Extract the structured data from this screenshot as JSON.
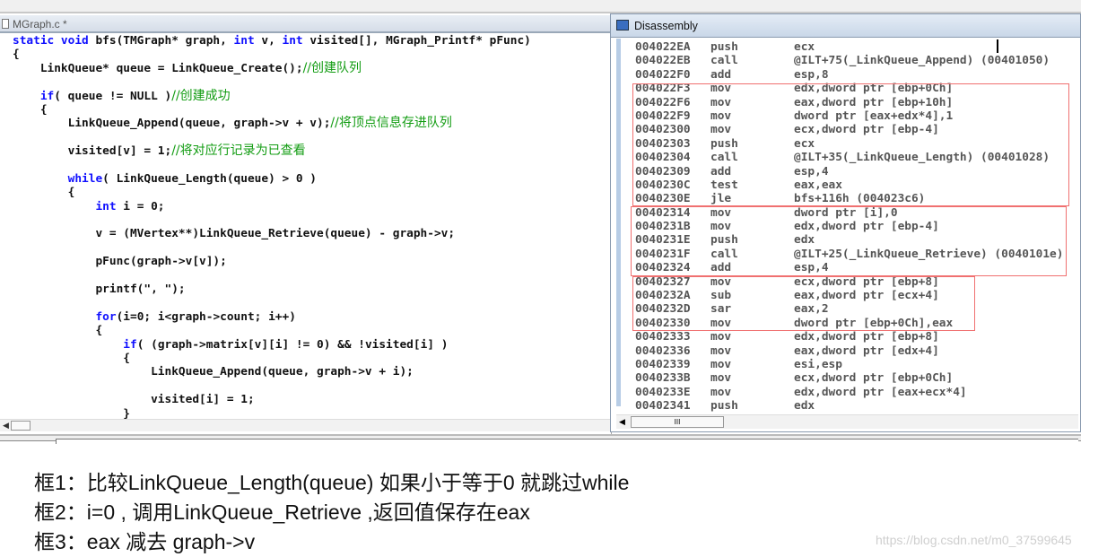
{
  "editor": {
    "tab_title": "MGraph.c *",
    "lines": [
      [
        {
          "t": "static void",
          "c": "kw"
        },
        {
          "t": " bfs(TMGraph* graph, ",
          "c": "tx"
        },
        {
          "t": "int",
          "c": "kw"
        },
        {
          "t": " v, ",
          "c": "tx"
        },
        {
          "t": "int",
          "c": "kw"
        },
        {
          "t": " visited[], MGraph_Printf* pFunc)",
          "c": "tx"
        }
      ],
      [
        {
          "t": "{",
          "c": "tx"
        }
      ],
      [
        {
          "t": "    LinkQueue* queue = LinkQueue_Create();",
          "c": "tx"
        },
        {
          "t": "//创建队列",
          "c": "cm"
        }
      ],
      [],
      [
        {
          "t": "    ",
          "c": "tx"
        },
        {
          "t": "if",
          "c": "kw"
        },
        {
          "t": "( queue != NULL )",
          "c": "tx"
        },
        {
          "t": "//创建成功",
          "c": "cm"
        }
      ],
      [
        {
          "t": "    {",
          "c": "tx"
        }
      ],
      [
        {
          "t": "        LinkQueue_Append(queue, graph->v + v);",
          "c": "tx"
        },
        {
          "t": "//将顶点信息存进队列",
          "c": "cm"
        }
      ],
      [],
      [
        {
          "t": "        visited[v] = 1;",
          "c": "tx"
        },
        {
          "t": "//将对应行记录为已查看",
          "c": "cm"
        }
      ],
      [],
      [
        {
          "t": "        ",
          "c": "tx"
        },
        {
          "t": "while",
          "c": "kw"
        },
        {
          "t": "( LinkQueue_Length(queue) > 0 )",
          "c": "tx"
        }
      ],
      [
        {
          "t": "        {",
          "c": "tx"
        }
      ],
      [
        {
          "t": "            ",
          "c": "tx"
        },
        {
          "t": "int",
          "c": "kw"
        },
        {
          "t": " i = 0;",
          "c": "tx"
        }
      ],
      [],
      [
        {
          "t": "            v = (MVertex**)LinkQueue_Retrieve(queue) - graph->v;",
          "c": "tx"
        }
      ],
      [],
      [
        {
          "t": "            pFunc(graph->v[v]);",
          "c": "tx"
        }
      ],
      [],
      [
        {
          "t": "            printf(\", \");",
          "c": "tx"
        }
      ],
      [],
      [
        {
          "t": "            ",
          "c": "tx"
        },
        {
          "t": "for",
          "c": "kw"
        },
        {
          "t": "(i=0; i<graph->count; i++)",
          "c": "tx"
        }
      ],
      [
        {
          "t": "            {",
          "c": "tx"
        }
      ],
      [
        {
          "t": "                ",
          "c": "tx"
        },
        {
          "t": "if",
          "c": "kw"
        },
        {
          "t": "( (graph->matrix[v][i] != 0) && !visited[i] )",
          "c": "tx"
        }
      ],
      [
        {
          "t": "                {",
          "c": "tx"
        }
      ],
      [
        {
          "t": "                    LinkQueue_Append(queue, graph->v + i);",
          "c": "tx"
        }
      ],
      [],
      [
        {
          "t": "                    visited[i] = 1;",
          "c": "tx"
        }
      ],
      [
        {
          "t": "                }",
          "c": "tx"
        }
      ]
    ]
  },
  "disassembly": {
    "title": "Disassembly",
    "rows": [
      [
        "004022EA",
        "push",
        "ecx"
      ],
      [
        "004022EB",
        "call",
        "@ILT+75(_LinkQueue_Append) (00401050)"
      ],
      [
        "004022F0",
        "add",
        "esp,8"
      ],
      [
        "004022F3",
        "mov",
        "edx,dword ptr [ebp+0Ch]"
      ],
      [
        "004022F6",
        "mov",
        "eax,dword ptr [ebp+10h]"
      ],
      [
        "004022F9",
        "mov",
        "dword ptr [eax+edx*4],1"
      ],
      [
        "00402300",
        "mov",
        "ecx,dword ptr [ebp-4]"
      ],
      [
        "00402303",
        "push",
        "ecx"
      ],
      [
        "00402304",
        "call",
        "@ILT+35(_LinkQueue_Length) (00401028)"
      ],
      [
        "00402309",
        "add",
        "esp,4"
      ],
      [
        "0040230C",
        "test",
        "eax,eax"
      ],
      [
        "0040230E",
        "jle",
        "bfs+116h (004023c6)"
      ],
      [
        "00402314",
        "mov",
        "dword ptr [i],0"
      ],
      [
        "0040231B",
        "mov",
        "edx,dword ptr [ebp-4]"
      ],
      [
        "0040231E",
        "push",
        "edx"
      ],
      [
        "0040231F",
        "call",
        "@ILT+25(_LinkQueue_Retrieve) (0040101e)"
      ],
      [
        "00402324",
        "add",
        "esp,4"
      ],
      [
        "00402327",
        "mov",
        "ecx,dword ptr [ebp+8]"
      ],
      [
        "0040232A",
        "sub",
        "eax,dword ptr [ecx+4]"
      ],
      [
        "0040232D",
        "sar",
        "eax,2"
      ],
      [
        "00402330",
        "mov",
        "dword ptr [ebp+0Ch],eax"
      ],
      [
        "00402333",
        "mov",
        "edx,dword ptr [ebp+8]"
      ],
      [
        "00402336",
        "mov",
        "eax,dword ptr [edx+4]"
      ],
      [
        "00402339",
        "mov",
        "esi,esp"
      ],
      [
        "0040233B",
        "mov",
        "ecx,dword ptr [ebp+0Ch]"
      ],
      [
        "0040233E",
        "mov",
        "edx,dword ptr [eax+ecx*4]"
      ],
      [
        "00402341",
        "push",
        "edx"
      ]
    ],
    "scroll_thumb_label": "III",
    "highlight_color": "#f07070"
  },
  "notes": [
    "框1：比较LinkQueue_Length(queue) 如果小于等于0 就跳过while",
    "框2：i=0 , 调用LinkQueue_Retrieve ,返回值保存在eax",
    "框3：eax 减去 graph->v"
  ],
  "watermark": "https://blog.csdn.net/m0_37599645"
}
